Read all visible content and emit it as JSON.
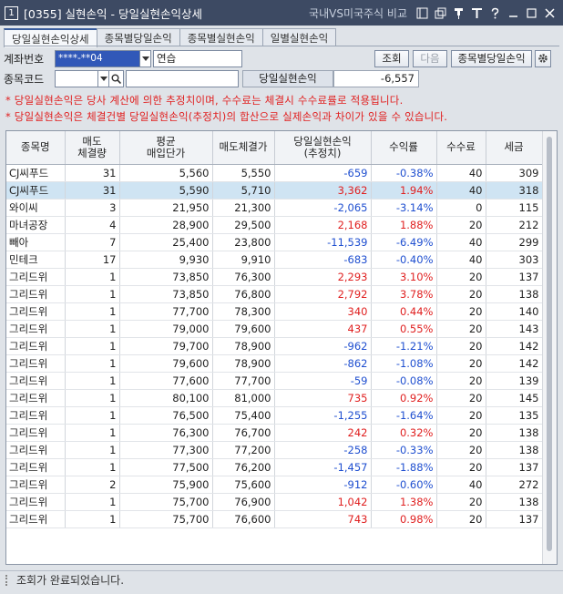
{
  "window": {
    "screen_no": "1",
    "title": "[0355] 실현손익 - 당일실현손익상세",
    "compare_link": "국내VS미국주식 비교",
    "icons": [
      "window-list-icon",
      "copy-window-icon",
      "pin-icon",
      "font-size-icon",
      "help-icon",
      "minimize-icon",
      "maximize-icon",
      "close-icon"
    ],
    "title_bg": "#3d4a63"
  },
  "tabs": [
    "당일실현손익상세",
    "종목별당일손익",
    "종목별실현손익",
    "일별실현손익"
  ],
  "form": {
    "account_label": "계좌번호",
    "account_value": "****-**04",
    "account_name": "연습",
    "query_button": "조회",
    "next_button": "다음",
    "stock_pnl_button": "종목별당일손익",
    "code_label": "종목코드",
    "code_value": "",
    "pnl_label": "당일실현손익",
    "pnl_value": "-6,557"
  },
  "notices": [
    "* 당일실현손익은 당사 계산에 의한 추정치이며, 수수료는 체결시 수수료률로 적용됩니다.",
    "* 당일실현손익은 체결건별 당일실현손익(추정치)의 합산으로 실제손익과 차이가 있을 수 있습니다."
  ],
  "table": {
    "headers": [
      {
        "line1": "종목명",
        "line2": ""
      },
      {
        "line1": "매도",
        "line2": "체결량"
      },
      {
        "line1": "평균",
        "line2": "매입단가"
      },
      {
        "line1": "매도체결가",
        "line2": ""
      },
      {
        "line1": "당일실현손익",
        "line2": "(추정치)"
      },
      {
        "line1": "수익률",
        "line2": ""
      },
      {
        "line1": "수수료",
        "line2": ""
      },
      {
        "line1": "세금",
        "line2": ""
      }
    ],
    "rows": [
      [
        "CJ씨푸드",
        "31",
        "5,560",
        "5,550",
        "-659",
        "-0.38%",
        "40",
        "309"
      ],
      [
        "CJ씨푸드",
        "31",
        "5,590",
        "5,710",
        "3,362",
        "1.94%",
        "40",
        "318"
      ],
      [
        "와이씨",
        "3",
        "21,950",
        "21,300",
        "-2,065",
        "-3.14%",
        "0",
        "115"
      ],
      [
        "마녀공장",
        "4",
        "28,900",
        "29,500",
        "2,168",
        "1.88%",
        "20",
        "212"
      ],
      [
        "빼아",
        "7",
        "25,400",
        "23,800",
        "-11,539",
        "-6.49%",
        "40",
        "299"
      ],
      [
        "민테크",
        "17",
        "9,930",
        "9,910",
        "-683",
        "-0.40%",
        "40",
        "303"
      ],
      [
        "그리드위",
        "1",
        "73,850",
        "76,300",
        "2,293",
        "3.10%",
        "20",
        "137"
      ],
      [
        "그리드위",
        "1",
        "73,850",
        "76,800",
        "2,792",
        "3.78%",
        "20",
        "138"
      ],
      [
        "그리드위",
        "1",
        "77,700",
        "78,300",
        "340",
        "0.44%",
        "20",
        "140"
      ],
      [
        "그리드위",
        "1",
        "79,000",
        "79,600",
        "437",
        "0.55%",
        "20",
        "143"
      ],
      [
        "그리드위",
        "1",
        "79,700",
        "78,900",
        "-962",
        "-1.21%",
        "20",
        "142"
      ],
      [
        "그리드위",
        "1",
        "79,600",
        "78,900",
        "-862",
        "-1.08%",
        "20",
        "142"
      ],
      [
        "그리드위",
        "1",
        "77,600",
        "77,700",
        "-59",
        "-0.08%",
        "20",
        "139"
      ],
      [
        "그리드위",
        "1",
        "80,100",
        "81,000",
        "735",
        "0.92%",
        "20",
        "145"
      ],
      [
        "그리드위",
        "1",
        "76,500",
        "75,400",
        "-1,255",
        "-1.64%",
        "20",
        "135"
      ],
      [
        "그리드위",
        "1",
        "76,300",
        "76,700",
        "242",
        "0.32%",
        "20",
        "138"
      ],
      [
        "그리드위",
        "1",
        "77,300",
        "77,200",
        "-258",
        "-0.33%",
        "20",
        "138"
      ],
      [
        "그리드위",
        "1",
        "77,500",
        "76,200",
        "-1,457",
        "-1.88%",
        "20",
        "137"
      ],
      [
        "그리드위",
        "2",
        "75,900",
        "75,600",
        "-912",
        "-0.60%",
        "40",
        "272"
      ],
      [
        "그리드위",
        "1",
        "75,700",
        "76,900",
        "1,042",
        "1.38%",
        "20",
        "138"
      ],
      [
        "그리드위",
        "1",
        "75,700",
        "76,600",
        "743",
        "0.98%",
        "20",
        "137"
      ]
    ],
    "selected_row": 1,
    "positive_color": "#e02020",
    "negative_color": "#1f4fd0"
  },
  "status": "조회가 완료되었습니다."
}
